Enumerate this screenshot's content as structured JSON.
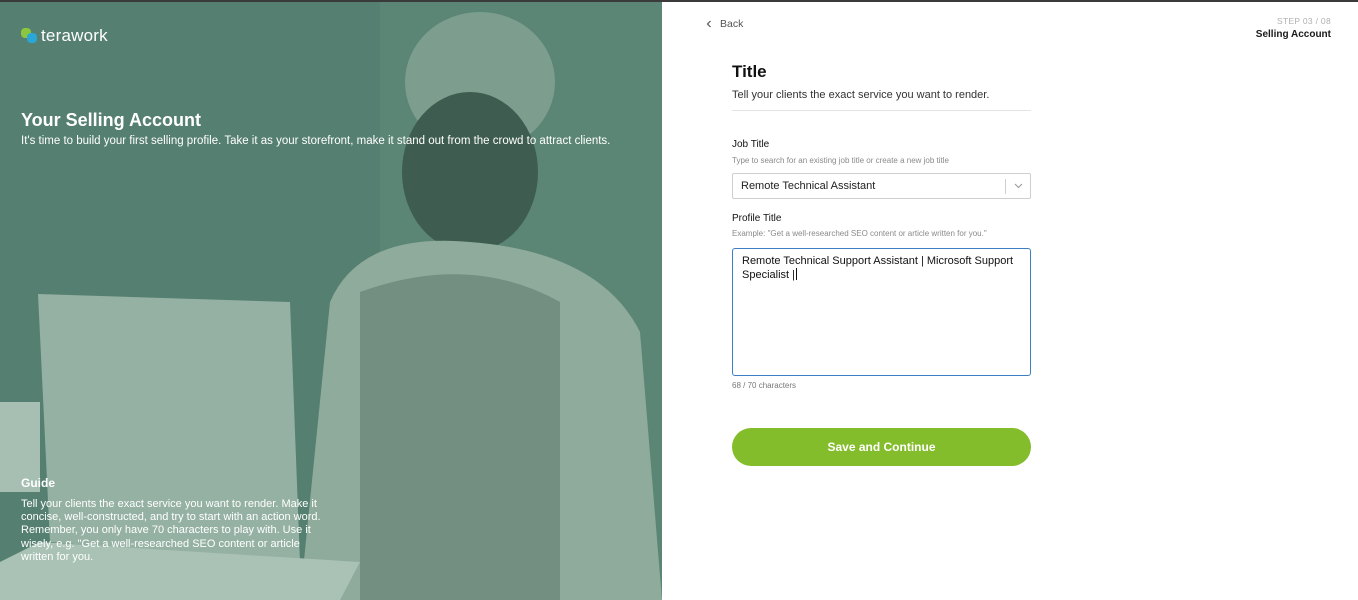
{
  "brand": {
    "name": "terawork",
    "colors": {
      "accent": "#84bd2b",
      "hero": "#5d8a79",
      "focus": "#3b7fc4"
    }
  },
  "hero": {
    "title": "Your Selling Account",
    "subtitle": "It's time to build your first selling profile. Take it as your storefront, make it stand out from the crowd to attract clients.",
    "guide_title": "Guide",
    "guide_text": "Tell your clients the exact service you want to render. Make it concise, well-constructed, and try to start with an action word. Remember, you only have 70 characters to play with. Use it wisely, e.g. \"Get a well-researched SEO content or article written for you."
  },
  "nav": {
    "back_label": "Back",
    "step_label": "STEP 03 / 08",
    "step_name": "Selling Account"
  },
  "form": {
    "title": "Title",
    "description": "Tell your clients the exact service you want to render.",
    "job_title": {
      "label": "Job Title",
      "hint": "Type to search for an existing job title or create a new job title",
      "value": "Remote Technical Assistant"
    },
    "profile_title": {
      "label": "Profile Title",
      "hint": "Example: \"Get a well-researched SEO content or article written for you.\"",
      "value": "Remote Technical Support Assistant | Microsoft Support Specialist |",
      "counter": "68 / 70 characters"
    },
    "save_label": "Save and Continue"
  },
  "icons": {
    "back": "chevron-left-icon",
    "select": "chevron-down-icon",
    "logo": "terawork-logo-icon"
  }
}
